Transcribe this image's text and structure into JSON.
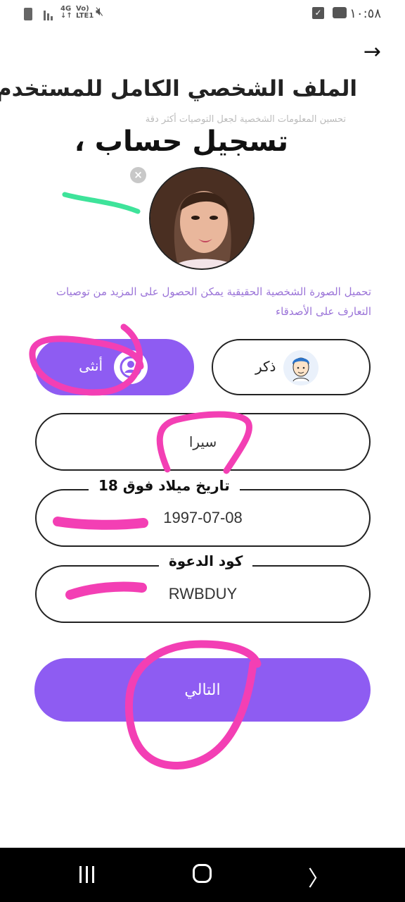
{
  "status_bar": {
    "network": "4G",
    "volte": "Vo)",
    "lte": "LTE1",
    "time": "١٠:٥٨"
  },
  "header": {
    "title": "الملف الشخصي الكامل للمستخدم",
    "subtitle": "تحسين المعلومات الشخصية لجعل التوصيات أكثر دقة"
  },
  "overlay": {
    "banner_text": "تسجيل حساب ،",
    "dob_label": "تاريخ ميلاد فوق 18",
    "invite_label": "كود الدعوة"
  },
  "profile": {
    "hint": "تحميل الصورة الشخصية الحقيقية يمكن الحصول على المزيد من توصيات التعارف على الأصدقاء"
  },
  "gender": {
    "female_label": "أنثى",
    "male_label": "ذكر"
  },
  "form": {
    "name_value": "سيرا",
    "dob_value": "1997-07-08",
    "invite_code_value": "RWBDUY"
  },
  "actions": {
    "next_label": "التالي"
  },
  "colors": {
    "accent": "#8e5cf2",
    "hint_text": "#9b74d8",
    "highlight": "#f33fb4",
    "green_mark": "#3ee39a"
  },
  "icons": [
    "battery-icon",
    "signal-icon",
    "mute-icon",
    "checkbox-icon",
    "message-icon",
    "back-arrow-icon",
    "close-icon",
    "female-icon",
    "male-avatar-icon",
    "recent-apps-icon",
    "home-icon",
    "back-nav-icon"
  ]
}
